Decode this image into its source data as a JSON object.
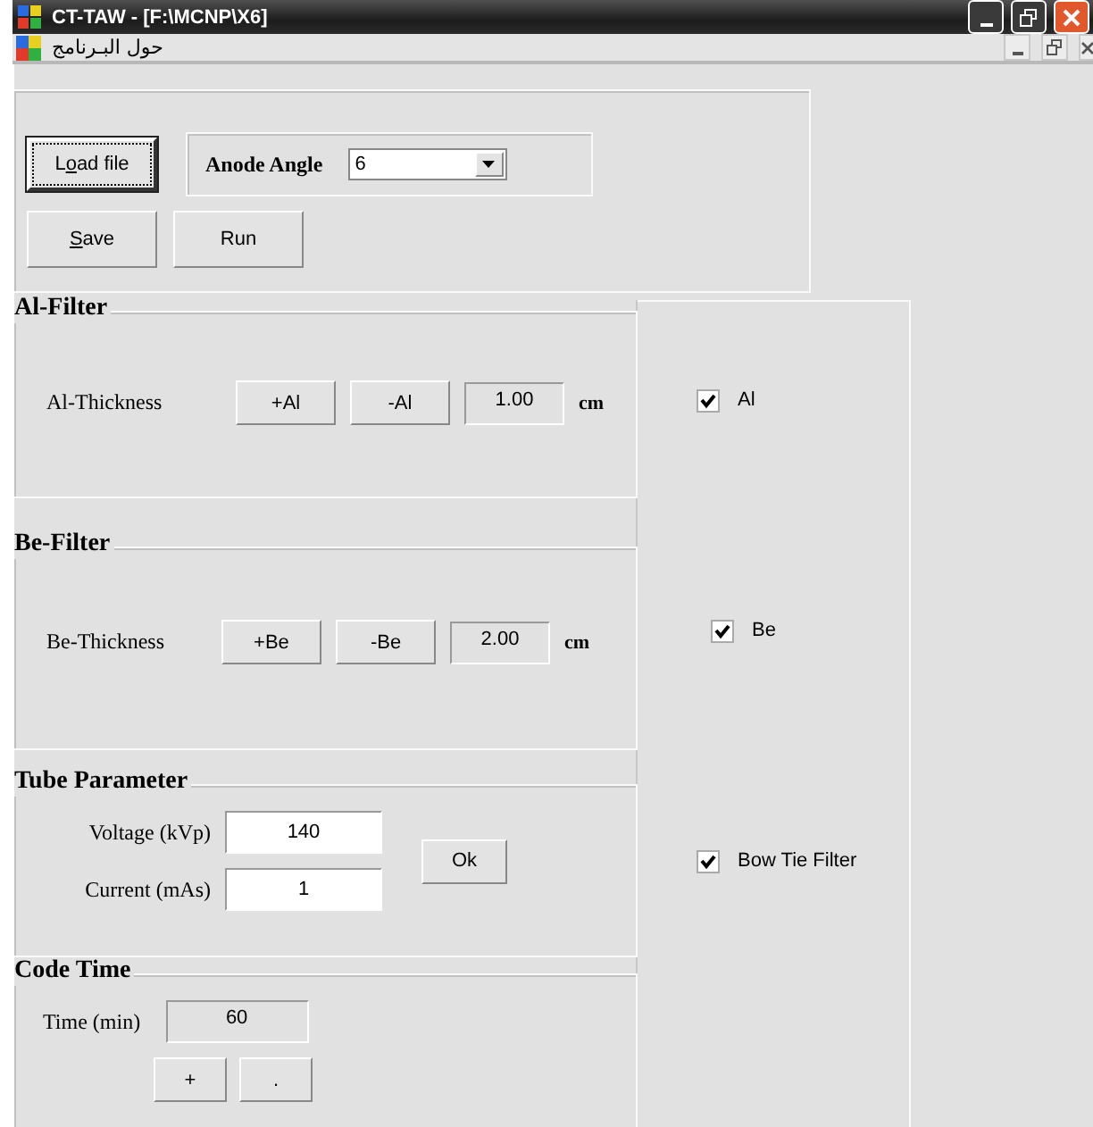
{
  "window": {
    "title": "CT-TAW - [F:\\MCNP\\X6]"
  },
  "menu_bar": {
    "label": "حول البـرنامج"
  },
  "file_panel": {
    "buttons": [
      {
        "before": "L",
        "key": "o",
        "after": "ad file",
        "focused": true
      },
      {
        "key": "S",
        "after": "ave",
        "focused": false
      },
      {
        "before": "Run",
        "focused": false
      }
    ],
    "anode_angle": {
      "label": "Anode Angle",
      "value": "6"
    }
  },
  "filters": [
    {
      "title": "Al-Filter",
      "label": "Al-Thickness",
      "plus": "+Al",
      "minus": "-Al",
      "value": "1.00",
      "unit": "cm"
    },
    {
      "title": "Be-Filter",
      "label": "Be-Thickness",
      "plus": "+Be",
      "minus": "-Be",
      "value": "2.00",
      "unit": "cm"
    }
  ],
  "tube_parameter": {
    "title": "Tube Parameter",
    "fields": [
      {
        "label": "Voltage (kVp)",
        "value": "140"
      },
      {
        "label": "Current (mAs)",
        "value": "1"
      }
    ],
    "button": "Ok"
  },
  "code_time": {
    "title": "Code Time",
    "label": "Time (min)",
    "value": "60",
    "buttons": [
      "+",
      "."
    ]
  },
  "options": [
    {
      "label": "Al",
      "checked": true
    },
    {
      "label": "Be",
      "checked": true
    },
    {
      "label": "Bow Tie Filter",
      "checked": true
    }
  ]
}
